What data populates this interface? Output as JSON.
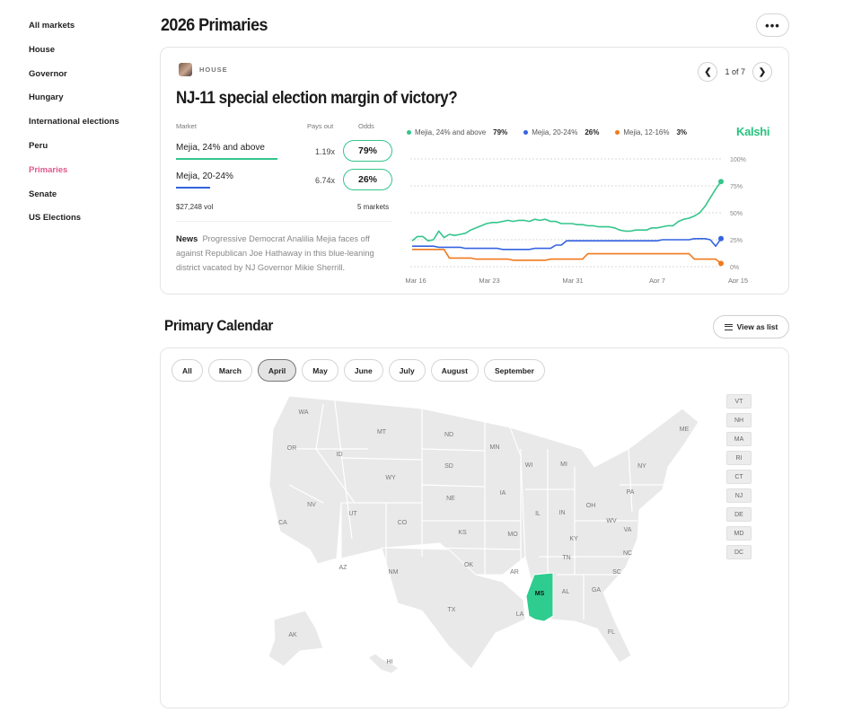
{
  "sidebar": {
    "items": [
      {
        "label": "All markets",
        "active": false
      },
      {
        "label": "House",
        "active": false
      },
      {
        "label": "Governor",
        "active": false
      },
      {
        "label": "Hungary",
        "active": false
      },
      {
        "label": "International elections",
        "active": false
      },
      {
        "label": "Peru",
        "active": false
      },
      {
        "label": "Primaries",
        "active": true
      },
      {
        "label": "Senate",
        "active": false
      },
      {
        "label": "US Elections",
        "active": false
      }
    ]
  },
  "header": {
    "title": "2026 Primaries",
    "more_label": "•••"
  },
  "market": {
    "category": "HOUSE",
    "pager": {
      "prev_icon": "chevron-left-icon",
      "next_icon": "chevron-right-icon",
      "text": "1 of 7"
    },
    "title": "NJ-11 special election margin of victory?",
    "headers": {
      "market": "Market",
      "pays_out": "Pays out",
      "odds": "Odds"
    },
    "outcomes": [
      {
        "label": "Mejia, 24% and above",
        "pays_out": "1.19x",
        "odds": "79%",
        "color": "#34c58c"
      },
      {
        "label": "Mejia, 20-24%",
        "pays_out": "6.74x",
        "odds": "26%",
        "color": "#3462e0"
      }
    ],
    "volume": "$27,248 vol",
    "markets_count": "5 markets",
    "news_label": "News",
    "news_text": "Progressive Democrat Analilia Mejia faces off against Republican Joe Hathaway in this blue-leaning district vacated by NJ Governor Mikie Sherrill.",
    "brand": "Kalshi"
  },
  "chart_data": {
    "type": "line",
    "x_tick_labels": [
      "Mar 16",
      "Mar 23",
      "Mar 31",
      "Apr 7",
      "Apr 15"
    ],
    "y_tick_labels": [
      "100%",
      "75%",
      "50%",
      "25%",
      "0%"
    ],
    "ylim": [
      0,
      100
    ],
    "grid": true,
    "legend_position": "top",
    "series": [
      {
        "name": "Mejia, 24% and above",
        "value_label": "79%",
        "color": "#34c58c",
        "values": [
          24,
          28,
          28,
          24,
          25,
          33,
          27,
          30,
          29,
          30,
          31,
          34,
          36,
          38,
          40,
          41,
          41,
          42,
          43,
          42,
          43,
          43,
          42,
          44,
          43,
          44,
          42,
          42,
          40,
          40,
          40,
          39,
          39,
          38,
          38,
          37,
          37,
          37,
          36,
          34,
          33,
          33,
          34,
          34,
          34,
          36,
          36,
          37,
          38,
          38,
          42,
          44,
          45,
          47,
          50,
          56,
          64,
          72,
          79
        ]
      },
      {
        "name": "Mejia, 20-24%",
        "value_label": "26%",
        "color": "#3462e0",
        "values": [
          19,
          19,
          19,
          19,
          19,
          18,
          18,
          18,
          18,
          18,
          17,
          17,
          17,
          17,
          17,
          17,
          17,
          16,
          16,
          16,
          16,
          16,
          16,
          17,
          17,
          17,
          17,
          20,
          20,
          24,
          24,
          24,
          24,
          24,
          24,
          24,
          24,
          24,
          24,
          24,
          24,
          24,
          24,
          24,
          24,
          24,
          24,
          25,
          25,
          25,
          25,
          25,
          25,
          26,
          26,
          26,
          25,
          19,
          26
        ]
      },
      {
        "name": "Mejia, 12-16%",
        "value_label": "3%",
        "color": "#f07a1e",
        "values": [
          16,
          16,
          16,
          16,
          16,
          16,
          16,
          8,
          8,
          8,
          8,
          8,
          7,
          7,
          7,
          7,
          7,
          7,
          7,
          6,
          6,
          6,
          6,
          6,
          6,
          6,
          7,
          7,
          7,
          7,
          7,
          7,
          7,
          12,
          12,
          12,
          12,
          12,
          12,
          12,
          12,
          12,
          12,
          12,
          12,
          12,
          12,
          12,
          12,
          12,
          12,
          12,
          12,
          7,
          7,
          7,
          7,
          7,
          3
        ]
      }
    ]
  },
  "calendar": {
    "title": "Primary Calendar",
    "list_button": "View as list",
    "months": [
      {
        "label": "All",
        "selected": false
      },
      {
        "label": "March",
        "selected": false
      },
      {
        "label": "April",
        "selected": true
      },
      {
        "label": "May",
        "selected": false
      },
      {
        "label": "June",
        "selected": false
      },
      {
        "label": "July",
        "selected": false
      },
      {
        "label": "August",
        "selected": false
      },
      {
        "label": "September",
        "selected": false
      }
    ],
    "highlight_color": "#2ecc8f",
    "states": [
      "WA",
      "MT",
      "ND",
      "MN",
      "ME",
      "OR",
      "ID",
      "WY",
      "SD",
      "WI",
      "MI",
      "NY",
      "NV",
      "UT",
      "NE",
      "IA",
      "PA",
      "CA",
      "CO",
      "KS",
      "MO",
      "IL",
      "IN",
      "OH",
      "WV",
      "VA",
      "KY",
      "AZ",
      "NM",
      "OK",
      "AR",
      "TN",
      "NC",
      "SC",
      "MS",
      "AL",
      "GA",
      "TX",
      "LA",
      "FL",
      "AK",
      "HI"
    ],
    "highlighted_state": "MS",
    "small_states": [
      "VT",
      "NH",
      "MA",
      "RI",
      "CT",
      "NJ",
      "DE",
      "MD",
      "DC"
    ]
  }
}
